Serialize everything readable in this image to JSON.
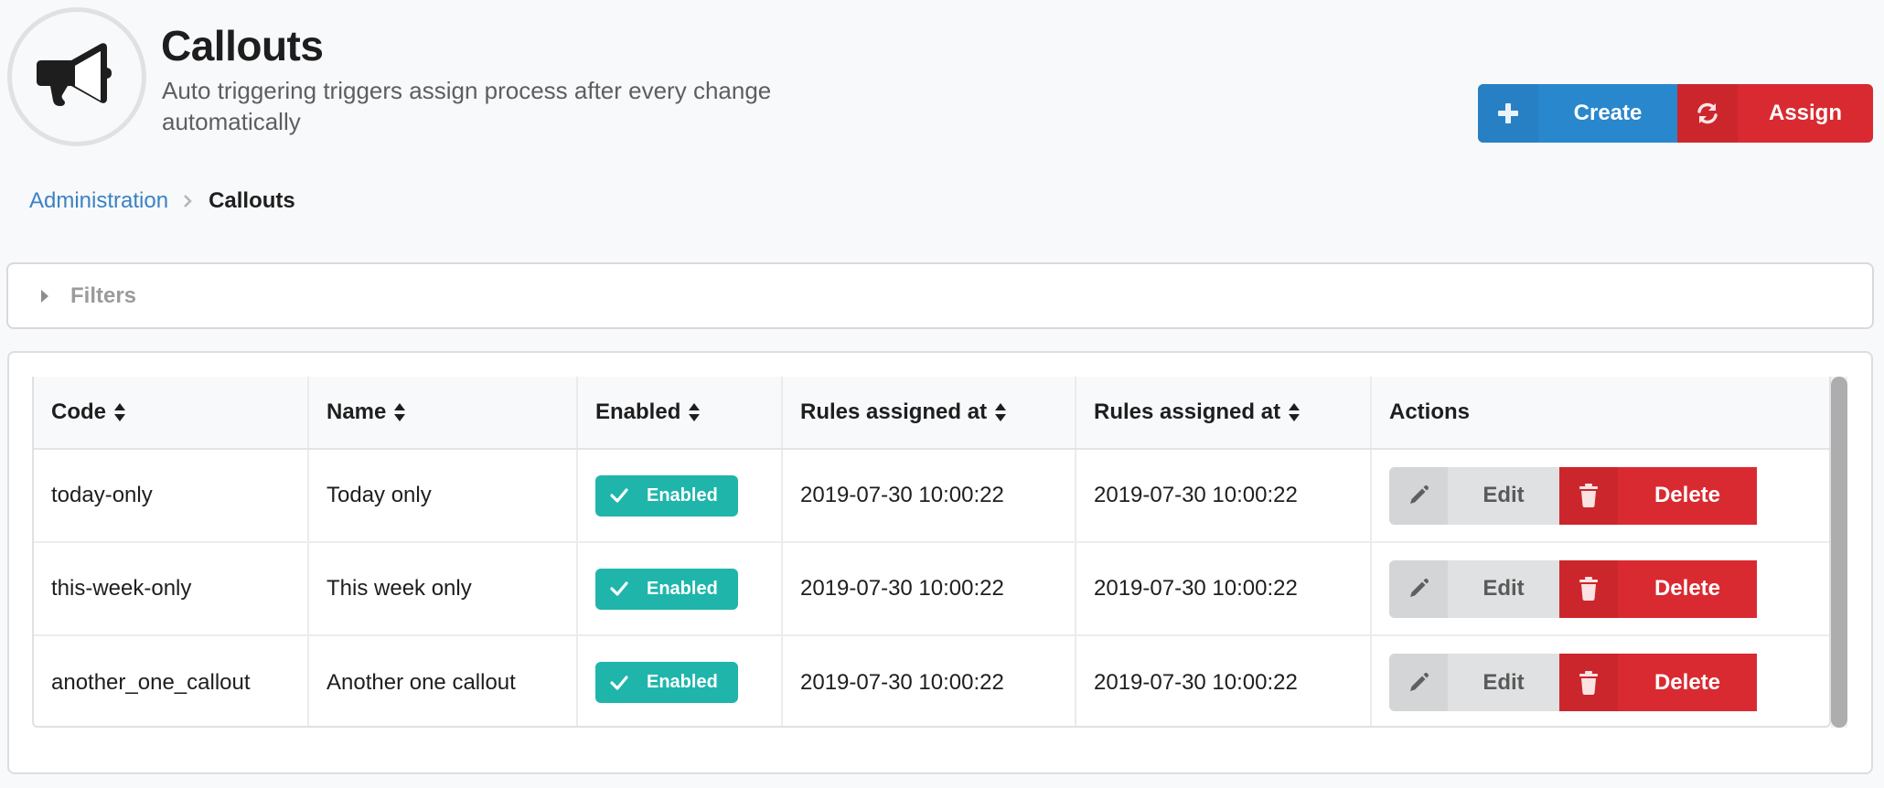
{
  "header": {
    "icon": "bullhorn-icon",
    "title": "Callouts",
    "subtitle": "Auto triggering triggers assign process after every change automatically"
  },
  "toolbar": {
    "create": {
      "icon": "plus-icon",
      "label": "Create",
      "color": "#2987cd"
    },
    "assign": {
      "icon": "sync-icon",
      "label": "Assign",
      "color": "#d92a31"
    }
  },
  "breadcrumb": {
    "items": [
      {
        "label": "Administration",
        "link": true
      },
      {
        "label": "Callouts",
        "link": false
      }
    ],
    "separator_icon": "chevron-right-icon"
  },
  "filters": {
    "label": "Filters",
    "expanded": false
  },
  "table": {
    "columns": [
      {
        "label": "Code",
        "sortable": true
      },
      {
        "label": "Name",
        "sortable": true
      },
      {
        "label": "Enabled",
        "sortable": true
      },
      {
        "label": "Rules assigned at",
        "sortable": true
      },
      {
        "label": "Rules assigned at",
        "sortable": true
      },
      {
        "label": "Actions",
        "sortable": false
      }
    ],
    "rows": [
      {
        "code": "today-only",
        "name": "Today only",
        "enabled": "Enabled",
        "assigned_at_1": "2019-07-30 10:00:22",
        "assigned_at_2": "2019-07-30 10:00:22"
      },
      {
        "code": "this-week-only",
        "name": "This week only",
        "enabled": "Enabled",
        "assigned_at_1": "2019-07-30 10:00:22",
        "assigned_at_2": "2019-07-30 10:00:22"
      },
      {
        "code": "another_one_callout",
        "name": "Another one callout",
        "enabled": "Enabled",
        "assigned_at_1": "2019-07-30 10:00:22",
        "assigned_at_2": "2019-07-30 10:00:22"
      }
    ],
    "row_actions": {
      "edit": {
        "icon": "pencil-icon",
        "label": "Edit"
      },
      "delete": {
        "icon": "trash-icon",
        "label": "Delete"
      }
    },
    "badge_color": "#1fb5ab"
  }
}
